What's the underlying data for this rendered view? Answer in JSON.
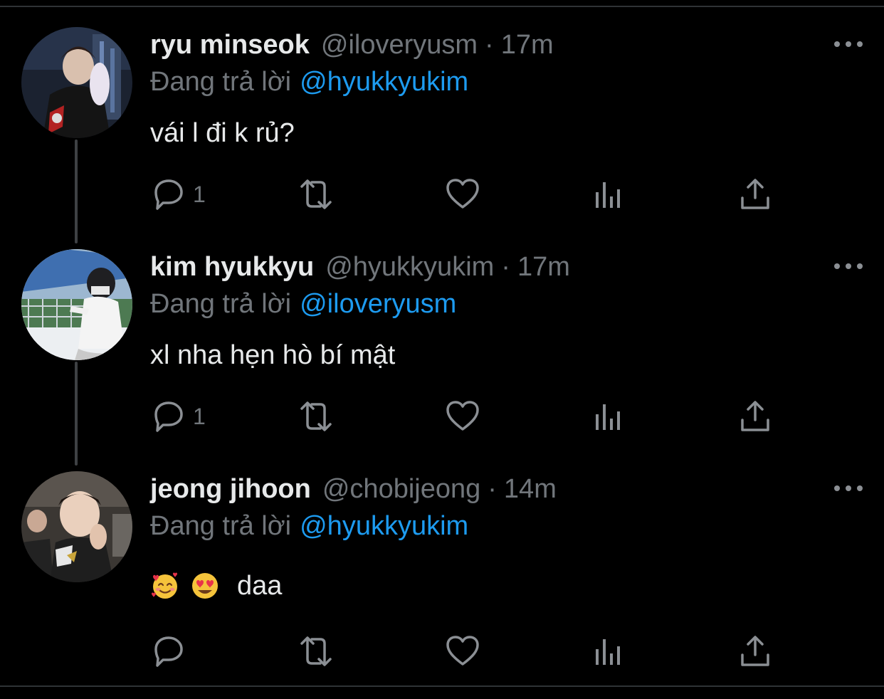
{
  "colors": {
    "background": "#000000",
    "text_primary": "#e7e9ea",
    "text_secondary": "#71767b",
    "link": "#1d9bf0",
    "thread_line": "#3e4144"
  },
  "reply_prefix": "Đang trả lời",
  "tweets": [
    {
      "name": "ryu minseok",
      "handle": "@iloveryusm",
      "separator": "·",
      "time": "17m",
      "reply_to": "@hyukkyukim",
      "text": "vái l đi k rủ?",
      "reply_count": "1",
      "avatar": "user-photo-ryu-minseok"
    },
    {
      "name": "kim hyukkyu",
      "handle": "@hyukkyukim",
      "separator": "·",
      "time": "17m",
      "reply_to": "@iloveryusm",
      "text": "xl nha hẹn hò bí mật",
      "reply_count": "1",
      "avatar": "user-photo-kim-hyukkyu"
    },
    {
      "name": "jeong jihoon",
      "handle": "@chobijeong",
      "separator": "·",
      "time": "14m",
      "reply_to": "@hyukkyukim",
      "text": "daa",
      "emojis": [
        "smiling-face-with-hearts",
        "heart-eyes"
      ],
      "reply_count": "",
      "avatar": "user-photo-jeong-jihoon"
    }
  ],
  "icons": {
    "reply": "reply-bubble-icon",
    "retweet": "retweet-icon",
    "like": "heart-icon",
    "views": "analytics-bars-icon",
    "share": "share-upload-icon",
    "more": "more-dots-icon"
  }
}
